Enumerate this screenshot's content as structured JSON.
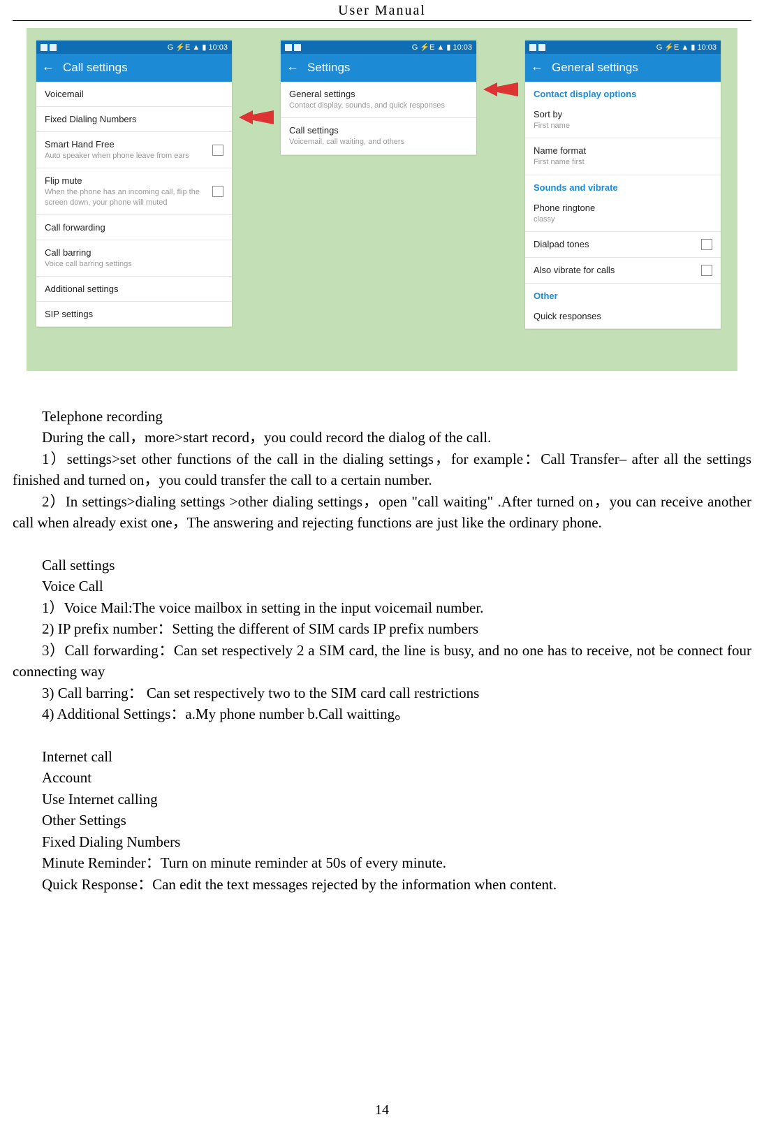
{
  "header": {
    "title": "User    Manual"
  },
  "status": {
    "time": "10:03",
    "icons": "G ⚡E ▲ ▮"
  },
  "screen1": {
    "title": "Call settings",
    "items": [
      {
        "title": "Voicemail",
        "sub": ""
      },
      {
        "title": "Fixed Dialing Numbers",
        "sub": ""
      },
      {
        "title": "Smart Hand Free",
        "sub": "Auto speaker when phone leave from ears",
        "check": true
      },
      {
        "title": "Flip mute",
        "sub": "When the phone has an incoming call, flip the screen down, your phone will muted",
        "check": true
      },
      {
        "title": "Call forwarding",
        "sub": ""
      },
      {
        "title": "Call barring",
        "sub": "Voice call barring settings"
      },
      {
        "title": "Additional settings",
        "sub": ""
      },
      {
        "title": "SIP settings",
        "sub": ""
      }
    ]
  },
  "screen2": {
    "title": "Settings",
    "items": [
      {
        "title": "General settings",
        "sub": "Contact display, sounds, and quick responses"
      },
      {
        "title": "Call settings",
        "sub": "Voicemail, call waiting, and others"
      }
    ]
  },
  "screen3": {
    "title": "General settings",
    "sections": [
      {
        "head": "Contact display options",
        "items": [
          {
            "title": "Sort by",
            "sub": "First name"
          },
          {
            "title": "Name format",
            "sub": "First name first"
          }
        ]
      },
      {
        "head": "Sounds and vibrate",
        "items": [
          {
            "title": "Phone ringtone",
            "sub": "classy"
          },
          {
            "title": "Dialpad tones",
            "sub": "",
            "check": true
          },
          {
            "title": "Also vibrate for calls",
            "sub": "",
            "check": true
          }
        ]
      },
      {
        "head": "Other",
        "items": [
          {
            "title": "Quick responses",
            "sub": ""
          }
        ]
      }
    ]
  },
  "text": {
    "p1": "Telephone recording",
    "p2": "During the call，more>start record，you could record the dialog of the call.",
    "p3": "1）settings>set other functions of the call in the dialing settings，for example：Call Transfer– after all the settings finished and turned on，you could transfer the call to a certain number.",
    "p4": "2）In settings>dialing settings >other dialing settings，open  \"call waiting\"  .After turned on，you can receive another call when already exist one，The answering and rejecting functions are just like the ordinary phone.",
    "p5": "Call settings",
    "p6": "Voice Call",
    "p7": "1）Voice Mail:The voice mailbox in setting in the input voicemail number.",
    "p8": "2) IP prefix number：Setting the different of SIM cards IP prefix numbers",
    "p9": "3）Call forwarding：Can set respectively 2 a SIM card, the line is busy, and no one has to receive, not be connect four connecting way",
    "p10": "3) Call barring：   Can set respectively two to the SIM card call restrictions",
    "p11": "4) Additional Settings：a.My phone number b.Call waitting。",
    "p12": "Internet call",
    "p13": "Account",
    "p14": "Use Internet calling",
    "p15": "Other Settings",
    "p16": "Fixed Dialing Numbers",
    "p17": "Minute Reminder：Turn on minute reminder at 50s of every minute.",
    "p18": "Quick Response：Can edit the text messages rejected by the information when content."
  },
  "page_number": "14"
}
